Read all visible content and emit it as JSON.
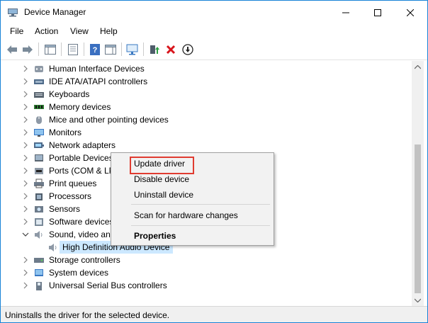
{
  "window": {
    "title": "Device Manager"
  },
  "menubar": {
    "items": [
      "File",
      "Action",
      "View",
      "Help"
    ]
  },
  "toolbar": {
    "buttons": [
      {
        "name": "back-arrow-icon"
      },
      {
        "name": "forward-arrow-icon"
      },
      {
        "name": "show-hide-console-tree-icon"
      },
      {
        "name": "properties-icon"
      },
      {
        "name": "help-icon"
      },
      {
        "name": "action-pane-icon"
      },
      {
        "name": "scan-hardware-icon"
      },
      {
        "name": "update-driver-icon"
      },
      {
        "name": "uninstall-device-icon"
      },
      {
        "name": "disable-device-icon"
      }
    ]
  },
  "tree": {
    "items": [
      {
        "label": "Human Interface Devices",
        "icon": "hid-icon",
        "expanded": false
      },
      {
        "label": "IDE ATA/ATAPI controllers",
        "icon": "ide-controller-icon",
        "expanded": false
      },
      {
        "label": "Keyboards",
        "icon": "keyboard-icon",
        "expanded": false
      },
      {
        "label": "Memory devices",
        "icon": "memory-icon",
        "expanded": false
      },
      {
        "label": "Mice and other pointing devices",
        "icon": "mouse-icon",
        "expanded": false
      },
      {
        "label": "Monitors",
        "icon": "monitor-icon",
        "expanded": false
      },
      {
        "label": "Network adapters",
        "icon": "network-adapter-icon",
        "expanded": false
      },
      {
        "label": "Portable Devices",
        "icon": "portable-device-icon",
        "expanded": false
      },
      {
        "label": "Ports (COM & LPT)",
        "icon": "port-icon",
        "expanded": false
      },
      {
        "label": "Print queues",
        "icon": "printer-icon",
        "expanded": false
      },
      {
        "label": "Processors",
        "icon": "processor-icon",
        "expanded": false
      },
      {
        "label": "Sensors",
        "icon": "sensor-icon",
        "expanded": false
      },
      {
        "label": "Software devices",
        "icon": "software-device-icon",
        "expanded": false
      },
      {
        "label": "Sound, video and game controllers",
        "icon": "sound-icon",
        "expanded": true
      },
      {
        "label": "High Definition Audio Device",
        "icon": "speaker-icon",
        "child": true,
        "selected": true
      },
      {
        "label": "Storage controllers",
        "icon": "storage-controller-icon",
        "expanded": false
      },
      {
        "label": "System devices",
        "icon": "system-device-icon",
        "expanded": false
      },
      {
        "label": "Universal Serial Bus controllers",
        "icon": "usb-icon",
        "expanded": false
      }
    ]
  },
  "context_menu": {
    "update_driver": "Update driver",
    "disable_device": "Disable device",
    "uninstall_device": "Uninstall device",
    "scan_hardware": "Scan for hardware changes",
    "properties": "Properties"
  },
  "statusbar": {
    "text": "Uninstalls the driver for the selected device."
  },
  "colors": {
    "accent_border": "#1883d7",
    "selection": "#cce8ff",
    "highlight_box": "#e03c31"
  }
}
